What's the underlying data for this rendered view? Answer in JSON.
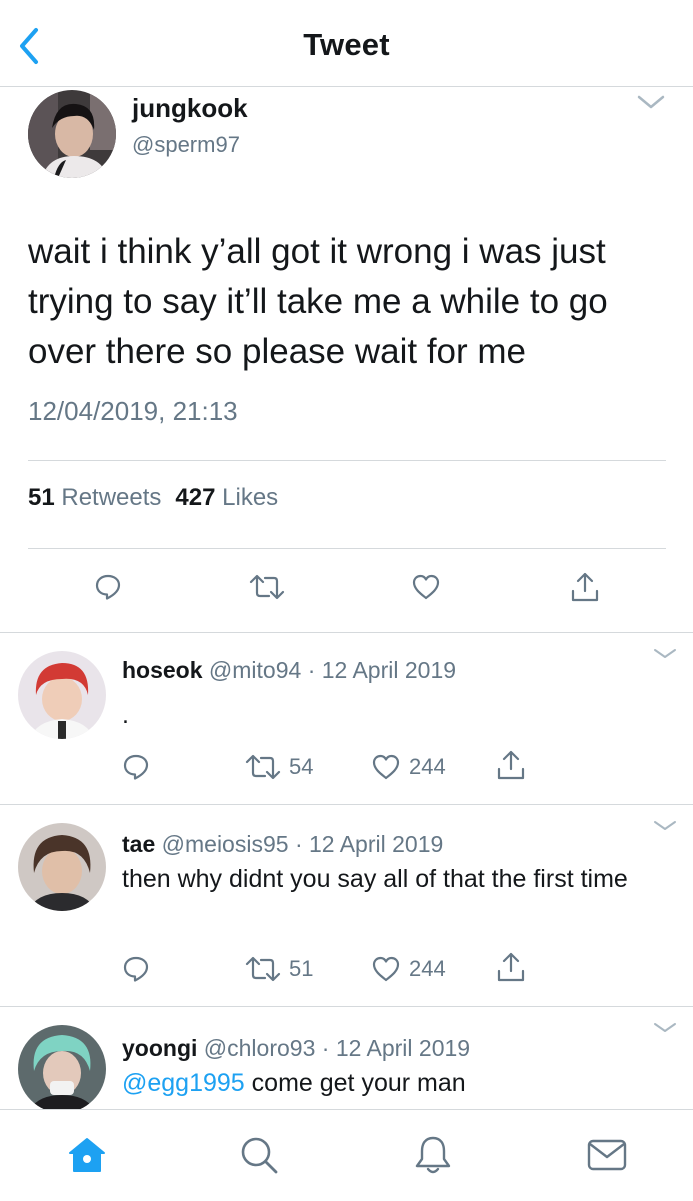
{
  "header": {
    "title": "Tweet",
    "back_icon": "chevron-left-icon",
    "accent_color": "#1da1f2"
  },
  "tweet": {
    "name": "jungkook",
    "handle": "@sperm97",
    "text": "wait i think y’all got it wrong i was just trying to say it’ll take me a while to go over there so please wait for me",
    "timestamp": "12/04/2019, 21:13",
    "retweets_count": "51",
    "retweets_label": "Retweets",
    "likes_count": "427",
    "likes_label": "Likes"
  },
  "replies": [
    {
      "name": "hoseok",
      "handle": "@mito94",
      "date": "12 April 2019",
      "text": ".",
      "mention": "",
      "retweets": "54",
      "likes": "244"
    },
    {
      "name": "tae",
      "handle": "@meiosis95",
      "date": "12 April 2019",
      "text": "then why didnt you say all of that the first time",
      "mention": "",
      "retweets": "51",
      "likes": "244"
    },
    {
      "name": "yoongi",
      "handle": "@chloro93",
      "date": "12 April 2019",
      "text": "come get your man",
      "mention": "@egg1995",
      "retweets": "",
      "likes": ""
    }
  ],
  "separator": "·",
  "tabbar": {
    "items": [
      "home-icon",
      "search-icon",
      "notifications-icon",
      "messages-icon"
    ],
    "active": "home-icon"
  }
}
